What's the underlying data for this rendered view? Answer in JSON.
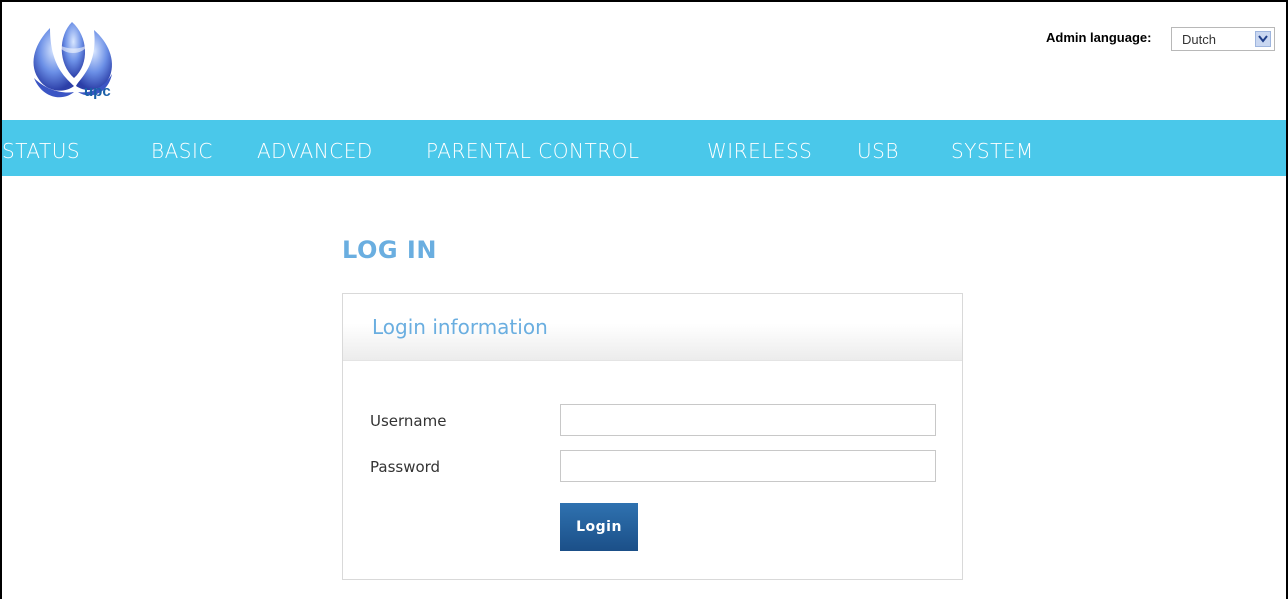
{
  "header": {
    "logo_text": "upc",
    "admin_language_label": "Admin language:",
    "admin_language_value": "Dutch"
  },
  "nav": {
    "items": [
      {
        "label": "STATUS"
      },
      {
        "label": "BASIC"
      },
      {
        "label": "ADVANCED"
      },
      {
        "label": "PARENTAL CONTROL"
      },
      {
        "label": "WIRELESS"
      },
      {
        "label": "USB"
      },
      {
        "label": "SYSTEM"
      }
    ]
  },
  "main": {
    "page_title": "LOG IN",
    "panel_title": "Login information",
    "username_label": "Username",
    "username_value": "",
    "password_label": "Password",
    "password_value": "",
    "login_button": "Login"
  },
  "colors": {
    "nav_bar": "#4ac8ea",
    "title_blue": "#6aaee0",
    "button_blue": "#1b4f88"
  },
  "icons": {
    "logo": "upc-logo-icon",
    "dropdown": "chevron-down-icon"
  }
}
